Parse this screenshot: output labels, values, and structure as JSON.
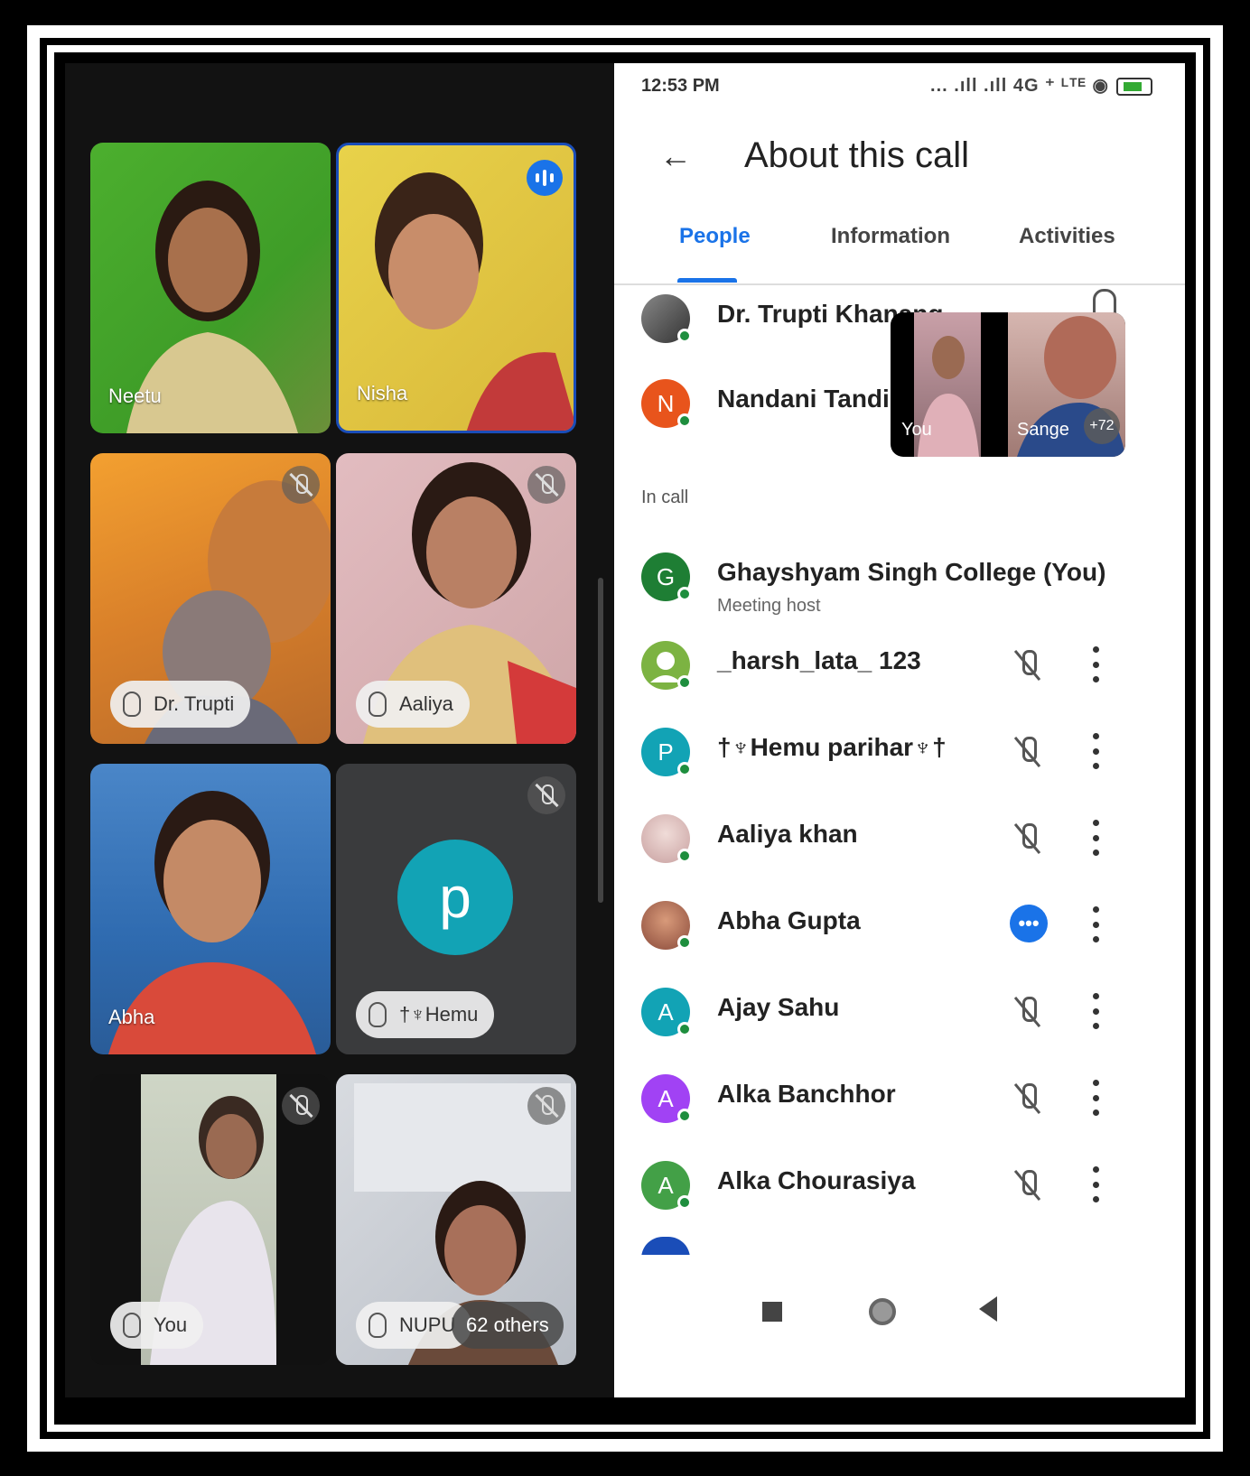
{
  "grid": {
    "tiles": [
      {
        "name": "Neetu",
        "raised": false
      },
      {
        "name": "Nisha",
        "raised": false
      },
      {
        "name": "Dr. Trupti",
        "raised": true
      },
      {
        "name": "Aaliya",
        "raised": true
      },
      {
        "name": "Abha",
        "raised": false
      },
      {
        "name": "†♆Hemu",
        "raised": true,
        "avatar_letter": "p"
      },
      {
        "name": "You",
        "raised": true
      },
      {
        "name": "NUPU",
        "raised": true,
        "overflow": "62 others"
      }
    ]
  },
  "status_bar": {
    "time": "12:53 PM",
    "icons": "... .ıll .ıll 4G ⁺ ᴸᵀᴱ"
  },
  "header": {
    "back_icon": "arrow-left-icon",
    "title": "About this call"
  },
  "tabs": [
    "People",
    "Information",
    "Activities"
  ],
  "pinned": [
    {
      "name": "Dr. Trupti Khanang",
      "avatar": "photo"
    },
    {
      "name": "Nandani Tandi",
      "avatar": "N",
      "color": "#e8541c"
    }
  ],
  "pip": {
    "left_label": "You",
    "right_label": "Sange",
    "badge": "+72"
  },
  "in_call_label": "In call",
  "people": [
    {
      "name": "Ghayshyam Singh College (You)",
      "sub": "Meeting host",
      "avatar": "G",
      "color": "#1e7e34",
      "action": "none"
    },
    {
      "name": "_harsh_lata_ 123",
      "avatar": "person",
      "color": "#7cb342",
      "action": "mic-off"
    },
    {
      "name": "†♆Hemu parihar♆†",
      "avatar": "P",
      "color": "#12a3b5",
      "action": "mic-off"
    },
    {
      "name": "Aaliya khan",
      "avatar": "photo",
      "color": "#e0c8c8",
      "action": "mic-off"
    },
    {
      "name": "Abha Gupta",
      "avatar": "photo",
      "color": "#b3806a",
      "action": "more"
    },
    {
      "name": "Ajay Sahu",
      "avatar": "A",
      "color": "#12a3b5",
      "action": "mic-off"
    },
    {
      "name": "Alka Banchhor",
      "avatar": "A",
      "color": "#a142f4",
      "action": "mic-off"
    },
    {
      "name": "Alka Chourasiya",
      "avatar": "A",
      "color": "#43a047",
      "action": "mic-off"
    }
  ]
}
